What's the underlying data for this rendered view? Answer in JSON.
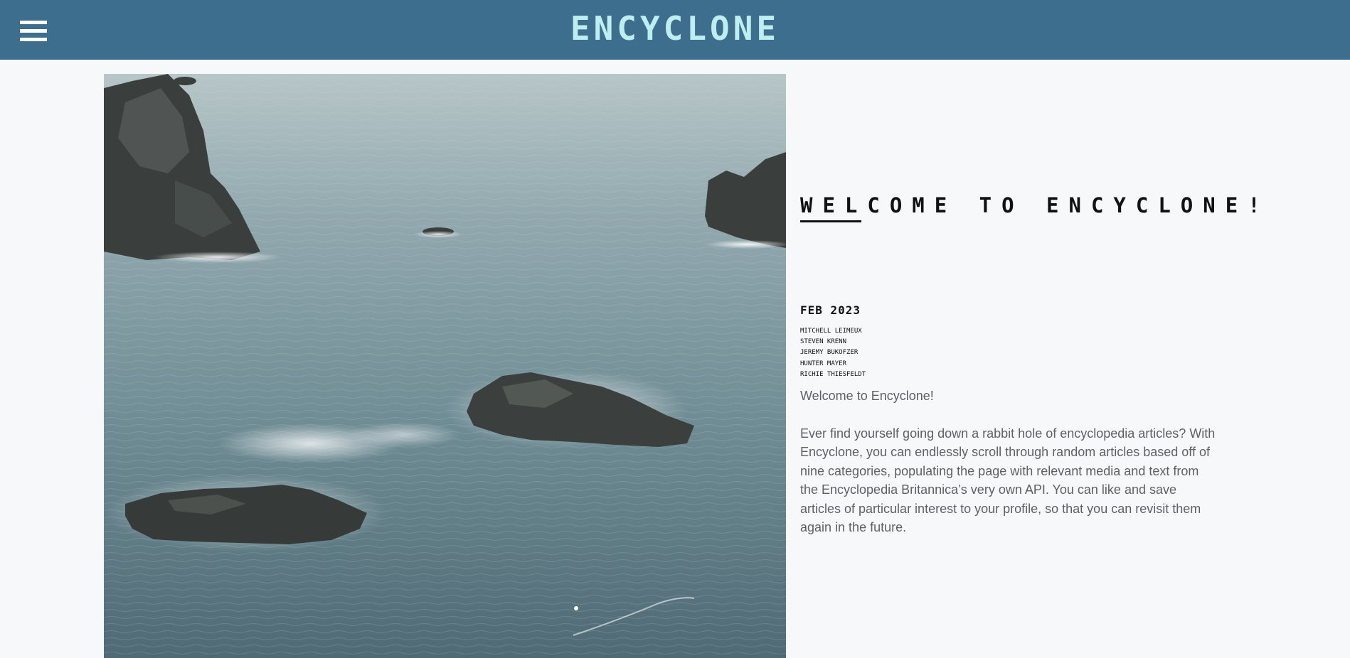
{
  "header": {
    "brand": "ENCYCLONE",
    "menu_icon": "hamburger-menu-icon",
    "background": "#3d6e8e",
    "brand_color": "#bfeef0"
  },
  "hero": {
    "image": "aerial view of sea rocks in ocean"
  },
  "main": {
    "title": "WELCOME TO ENCYCLONE!",
    "date": "FEB 2023",
    "authors": [
      "MITCHELL LEIMEUX",
      "STEVEN KRENN",
      "JEREMY BUKOFZER",
      "HUNTER MAYER",
      "RICHIE THIESFELDT"
    ],
    "intro": "Welcome to Encyclone!",
    "description": "Ever find yourself going down a rabbit hole of encyclopedia articles? With Encyclone, you can endlessly scroll through random articles based off of nine categories, populating the page with relevant media and text from the Encyclopedia Britannica’s very own API. You can like and save articles of particular interest to your profile, so that you can revisit them again in the future."
  }
}
